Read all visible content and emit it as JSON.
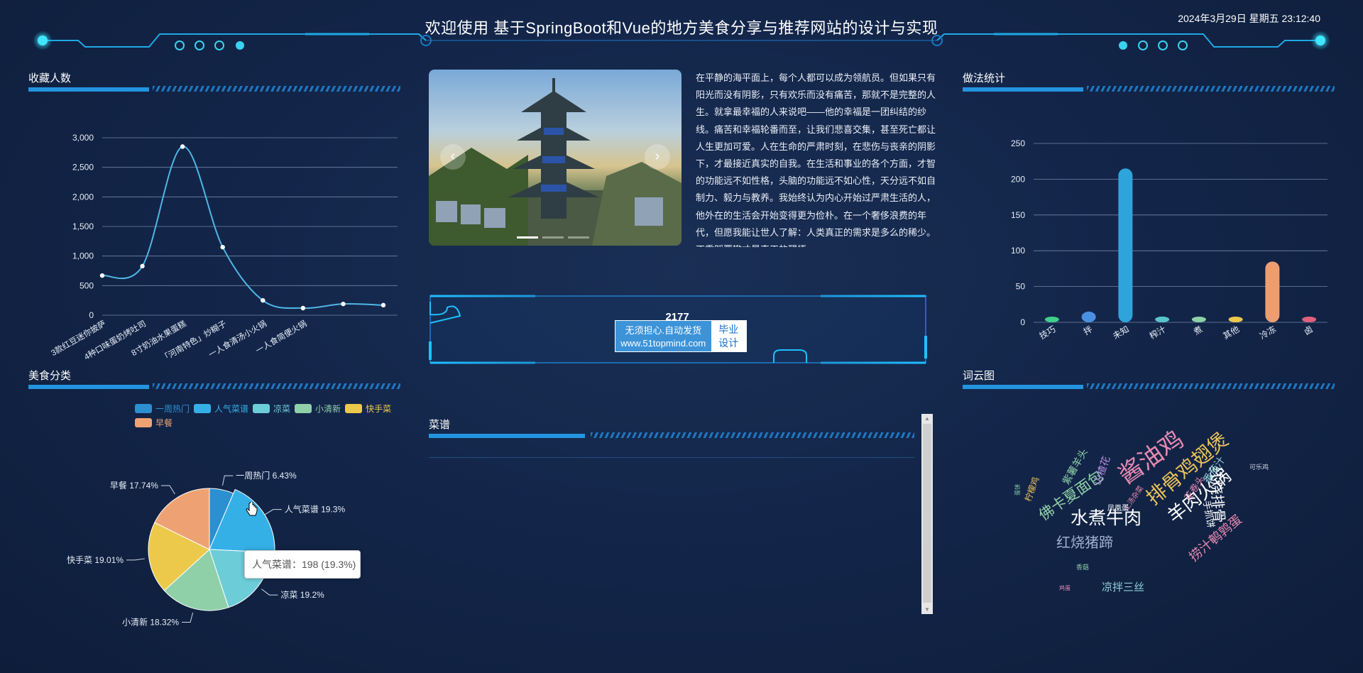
{
  "header": {
    "title": "欢迎使用 基于SpringBoot和Vue的地方美食分享与推荐网站的设计与实现",
    "datetime": "2024年3月29日 星期五 23:12:40"
  },
  "panels": {
    "favorites": "收藏人数",
    "category": "美食分类",
    "method": "做法统计",
    "wordcloud": "词云图",
    "recipe": "菜谱"
  },
  "intro_text": "在平静的海平面上，每个人都可以成为领航员。但如果只有阳光而没有阴影，只有欢乐而没有痛苦，那就不是完整的人生。就拿最幸福的人来说吧——他的幸福是一团纠结的纱线。痛苦和幸福轮番而至，让我们悲喜交集，甚至死亡都让人生更加可爱。人在生命的严肃时刻，在悲伤与丧亲的阴影下，才最接近真实的自我。在生活和事业的各个方面，才智的功能远不如性格，头脑的功能远不如心性，天分远不如自制力、毅力与教养。我始终认为内心开始过严肃生活的人，他外在的生活会开始变得更为俭朴。在一个奢侈浪费的年代，但愿我能让世人了解：人类真正的需求是多么的稀少。不重蹈覆辙才是真正的醒悟。",
  "count_banner": {
    "value": "2177"
  },
  "ad": {
    "line1": "无须担心.自动发货",
    "line2": "www.51topmind.com",
    "right1": "毕业",
    "right2": "设计"
  },
  "carousel": {
    "prev": "‹",
    "next": "›"
  },
  "colors": {
    "accent": "#2394e0",
    "line": "#4fb6e6",
    "bar": "#2fa4dc"
  },
  "chart_data": [
    {
      "type": "line",
      "title": "收藏人数",
      "x": [
        "3款红豆迷你披萨",
        "4种口味蛋奶烤吐司",
        "8寸奶油水果蛋糕",
        "「河南特色」炒糊子",
        "一人食清汤小火锅",
        "一人食简便火锅",
        "",
        ""
      ],
      "values": [
        670,
        830,
        2850,
        1150,
        250,
        120,
        190,
        170
      ],
      "y_ticks": [
        "0",
        "500",
        "1,000",
        "1,500",
        "2,000",
        "2,500",
        "3,000"
      ],
      "ylim": [
        0,
        3000
      ],
      "grid": true
    },
    {
      "type": "pie",
      "title": "美食分类",
      "legend_position": "top-right",
      "slices": [
        {
          "name": "一周热门",
          "value": 6.43,
          "label": "一周热门 6.43%",
          "color": "#2b8fd0"
        },
        {
          "name": "人气菜谱",
          "value": 19.3,
          "label": "人气菜谱 19.3%",
          "color": "#34b0e6"
        },
        {
          "name": "凉菜",
          "value": 19.2,
          "label": "凉菜 19.2%",
          "color": "#6cccd8"
        },
        {
          "name": "小清新",
          "value": 18.32,
          "label": "小清新 18.32%",
          "color": "#8fd0a8"
        },
        {
          "name": "快手菜",
          "value": 19.01,
          "label": "快手菜 19.01%",
          "color": "#ecc94b"
        },
        {
          "name": "早餐",
          "value": 17.74,
          "label": "早餐 17.74%",
          "color": "#eea274"
        }
      ],
      "tooltip": "人气菜谱：198 (19.3%)"
    },
    {
      "type": "bar",
      "title": "做法统计",
      "categories": [
        "技巧",
        "拌",
        "未知",
        "榨汁",
        "煮",
        "其他",
        "冷冻",
        "卤"
      ],
      "values": [
        4,
        15,
        215,
        8,
        7,
        4,
        85,
        4
      ],
      "colors": [
        "#3fd08a",
        "#4a90e2",
        "#2fa4dc",
        "#59c4c9",
        "#8fd0a8",
        "#ecc94b",
        "#ee9d6e",
        "#e0607a"
      ],
      "y_ticks": [
        "0",
        "50",
        "100",
        "150",
        "200",
        "250"
      ],
      "ylim": [
        0,
        250
      ],
      "grid": true
    }
  ],
  "wordcloud": [
    {
      "text": "酱油鸡",
      "color": "#e58ab0"
    },
    {
      "text": "排骨鸡翅煲",
      "color": "#e9c25a"
    },
    {
      "text": "羊肉火锅",
      "color": "#ffffff"
    },
    {
      "text": "水煮牛肉",
      "color": "#ffffff"
    },
    {
      "text": "红烧猪蹄",
      "color": "#9fb0cf"
    },
    {
      "text": "佛卡夏面包",
      "color": "#8fd0a8"
    },
    {
      "text": "捞汁鹌鹑蛋",
      "color": "#e58ab0"
    },
    {
      "text": "凉拌三丝",
      "color": "#8fd0d8"
    },
    {
      "text": "红烧排骨",
      "color": "#ffffff"
    },
    {
      "text": "番茄汁",
      "color": "#8fd0d8"
    },
    {
      "text": "花卷头",
      "color": "#e58ab0"
    },
    {
      "text": "手抓饼",
      "color": "#ffffff"
    },
    {
      "text": "紫薯羊头",
      "color": "#8fd0a8"
    },
    {
      "text": "山楂花",
      "color": "#b48fdc"
    },
    {
      "text": "柠檬鸡",
      "color": "#e9c25a"
    },
    {
      "text": "上汤杂菜",
      "color": "#e58ab0"
    },
    {
      "text": "凤凰蛋",
      "color": "#ffffff"
    },
    {
      "text": "可乐鸡",
      "color": "#cfd6e4"
    },
    {
      "text": "香菇",
      "color": "#8fd0a8"
    },
    {
      "text": "鸡蛋",
      "color": "#e58ab0"
    },
    {
      "text": "蛋饼",
      "color": "#8fd0a8"
    }
  ]
}
